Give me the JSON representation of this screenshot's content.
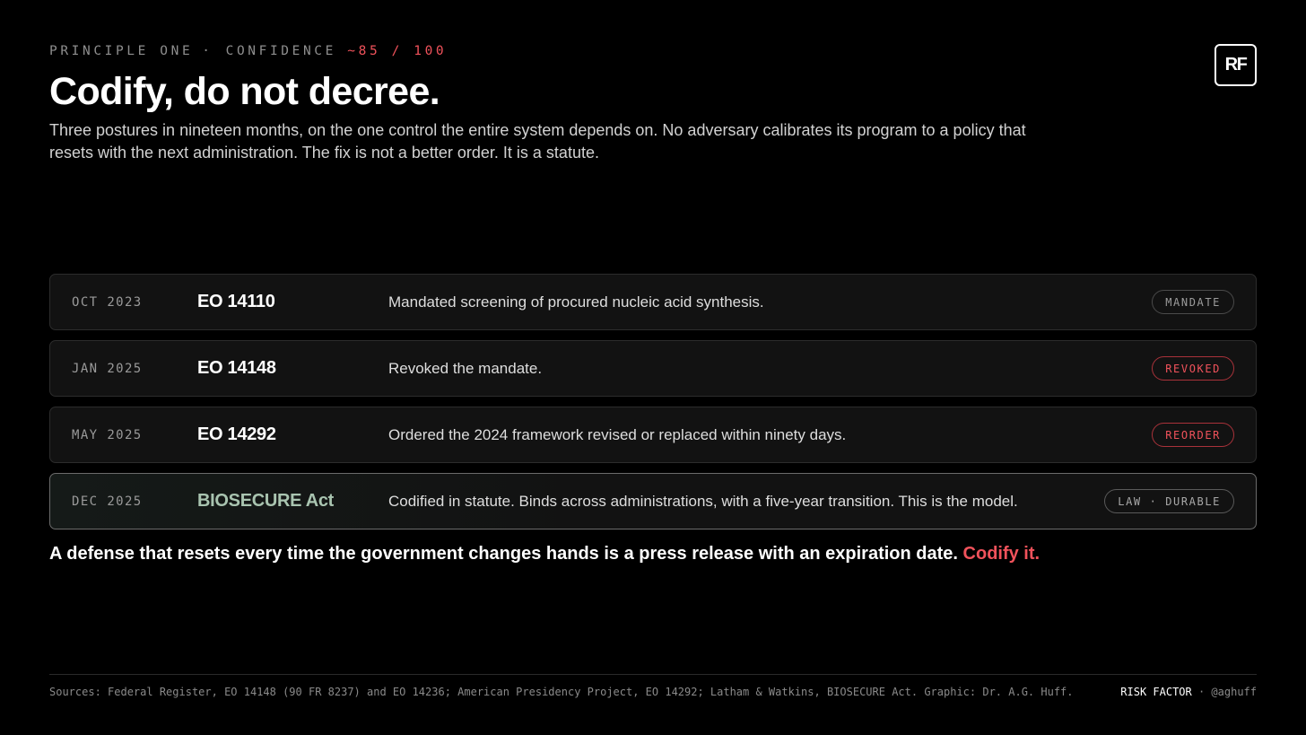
{
  "header": {
    "eyebrow_left": "PRINCIPLE ONE",
    "eyebrow_sep": "·",
    "eyebrow_label": "CONFIDENCE",
    "eyebrow_score": "~85 / 100",
    "logo": "RF",
    "title": "Codify, do not decree.",
    "subtitle": "Three postures in nineteen months, on the one control the entire system depends on. No adversary calibrates its program to a policy that resets with the next administration. The fix is not a better order. It is a statute."
  },
  "timeline": [
    {
      "date": "OCT 2023",
      "name": "EO 14110",
      "description": "Mandated screening of procured nucleic acid synthesis.",
      "badge": "MANDATE"
    },
    {
      "date": "JAN 2025",
      "name": "EO 14148",
      "description": "Revoked the mandate.",
      "badge": "REVOKED"
    },
    {
      "date": "MAY 2025",
      "name": "EO 14292",
      "description": "Ordered the 2024 framework revised or replaced within ninety days.",
      "badge": "REORDER"
    },
    {
      "date": "DEC 2025",
      "name": "BIOSECURE Act",
      "description": "Codified in statute. Binds across administrations, with a five-year transition. This is the model.",
      "badge": "LAW · DURABLE"
    }
  ],
  "callout": {
    "text": "A defense that resets every time the government changes hands is a press release with an expiration date.",
    "accent": "Codify it."
  },
  "footer": {
    "sources": "Sources: Federal Register, EO 14148 (90 FR 8237) and EO 14236; American Presidency Project, EO 14292; Latham & Watkins, BIOSECURE Act. Graphic: Dr. A.G. Huff.",
    "brand": "RISK FACTOR",
    "handle": " · @aghuff"
  },
  "colors": {
    "background": "#000000",
    "accent_red": "#f0525b",
    "accent_green": "#a9c4b0",
    "row_background": "#121212"
  }
}
